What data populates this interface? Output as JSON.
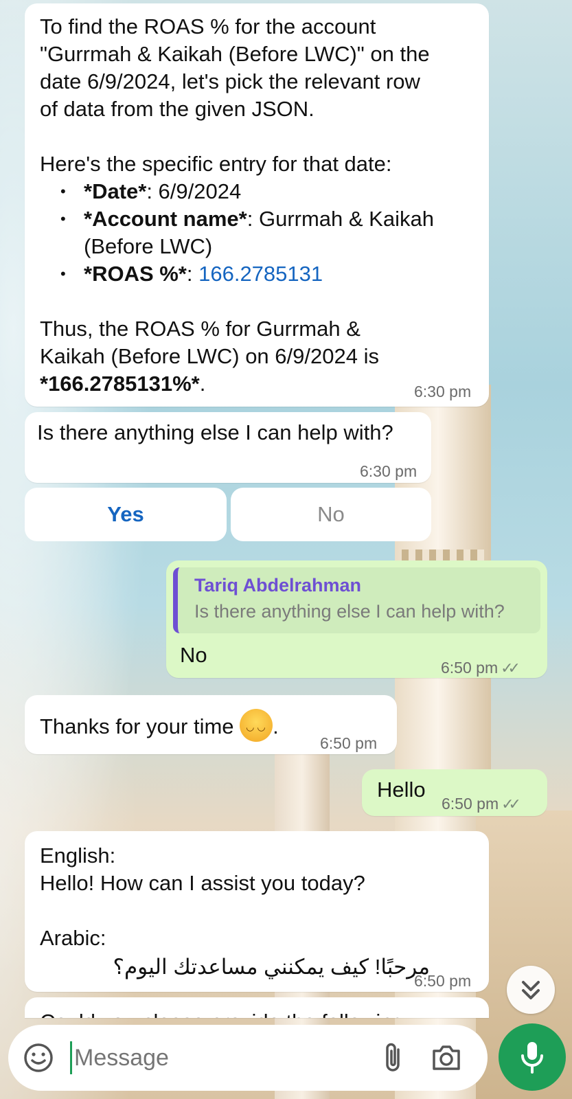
{
  "messages": {
    "roas_answer": {
      "line1": "To find the ROAS % for the account",
      "line2": "\"Gurrmah & Kaikah (Before LWC)\" on the",
      "line3": "date 6/9/2024, let's pick the relevant row",
      "line4": "of data from the given JSON.",
      "entry_intro": "Here's the specific entry for that date:",
      "bullets": [
        {
          "label": "*Date*",
          "value": ": 6/9/2024"
        },
        {
          "label": "*Account name*",
          "value": ": Gurrmah & Kaikah"
        },
        {
          "label": "*ROAS %*",
          "value": "166.2785131"
        }
      ],
      "bullet2_cont": "(Before LWC)",
      "bullet3_sep": ": ",
      "summary1": "Thus, the ROAS % for Gurrmah &",
      "summary2": "Kaikah (Before LWC) on 6/9/2024 is",
      "summary3": "*166.2785131%*",
      "summary3_end": ".",
      "time": "6:30 pm"
    },
    "help_prompt": {
      "text": "Is there anything else I can help with?",
      "time": "6:30 pm"
    },
    "quick_replies": [
      "Yes",
      "No"
    ],
    "reply_no": {
      "quoted_name": "Tariq Abdelrahman",
      "quoted_text": "Is there anything else I can help with?",
      "text": "No",
      "time": "6:50 pm",
      "ticks": "✓✓"
    },
    "thanks": {
      "text": "Thanks for your time",
      "emoji": "smiling-face-emoji",
      "end": ".",
      "time": "6:50 pm"
    },
    "hello": {
      "text": "Hello",
      "time": "6:50 pm",
      "ticks": "✓✓"
    },
    "greeting": {
      "english_label": "English:",
      "english_text": "Hello! How can I assist you today?",
      "arabic_label": "Arabic:",
      "arabic_text": "مرحبًا! كيف يمكنني مساعدتك اليوم؟",
      "time": "6:50 pm"
    },
    "partial": {
      "text": "Could you please provide the following"
    }
  },
  "composer": {
    "placeholder": "Message",
    "icons": [
      "emoji-icon",
      "attach-icon",
      "camera-icon",
      "mic-icon"
    ]
  },
  "scroll_down_icon": "double-chevron-down-icon",
  "colors": {
    "incoming": "#ffffff",
    "outgoing": "#dcf8c6",
    "accent_green": "#1e9e57",
    "link_blue": "#1565c0",
    "quote_purple": "#6e4fd3"
  }
}
